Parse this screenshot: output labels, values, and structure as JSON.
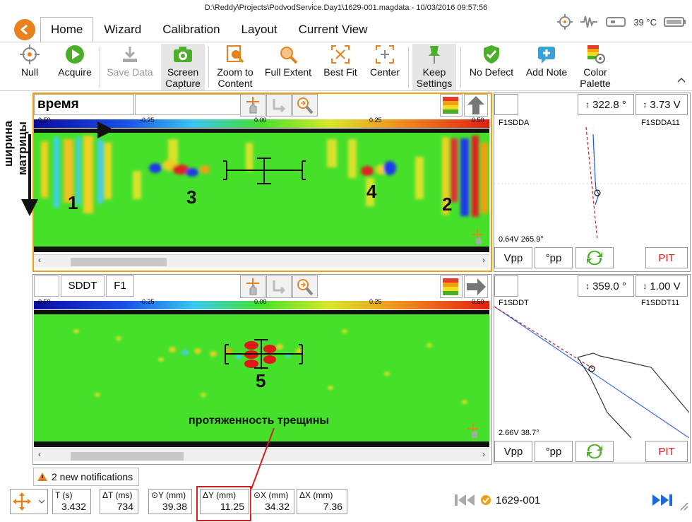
{
  "window": {
    "title": "D:\\Reddy\\Projects\\PodvodService.Day1\\1629-001.magdata - 10/03/2016 09:57:56"
  },
  "tabs": [
    "Home",
    "Wizard",
    "Calibration",
    "Layout",
    "Current View"
  ],
  "status": {
    "temperature": "39 °C"
  },
  "ribbon": {
    "null": "Null",
    "acquire": "Acquire",
    "save_data": "Save Data",
    "screen_capture_1": "Screen",
    "screen_capture_2": "Capture",
    "zoom_1": "Zoom to",
    "zoom_2": "Content",
    "full_extent": "Full Extent",
    "best_fit": "Best Fit",
    "center": "Center",
    "keep_1": "Keep",
    "keep_2": "Settings",
    "no_defect": "No Defect",
    "add_note": "Add Note",
    "palette_1": "Color",
    "palette_2": "Palette"
  },
  "scale": {
    "t0": "-0.50",
    "t1": "-0.25",
    "t2": "0.00",
    "t3": "0.25",
    "t4": "0.50"
  },
  "top_panel": {
    "title": "время",
    "channel_left": "F1SDDA",
    "channel_right": "F1SDDA11",
    "angle": "322.8 °",
    "volts": "3.73 V",
    "readout": "0.64V 265.9°",
    "btn_vpp": "Vpp",
    "btn_pp": "°pp",
    "btn_pit": "PIT"
  },
  "bottom_panel": {
    "ch1": "SDDT",
    "ch2": "F1",
    "channel_left": "F1SDDT",
    "channel_right": "F1SDDT11",
    "angle": "359.0 °",
    "volts": "1.00 V",
    "readout": "2.66V 38.7°",
    "btn_vpp": "Vpp",
    "btn_pp": "°pp",
    "btn_pit": "PIT"
  },
  "annotations": {
    "side_1": "ширина",
    "side_2": "матрицы",
    "n1": "1",
    "n2": "2",
    "n3": "3",
    "n4": "4",
    "n5": "5",
    "crack": "протяженность трещины"
  },
  "notifications": "2 new notifications",
  "measurements": [
    {
      "h": "T (s)",
      "v": "3.432"
    },
    {
      "h": "ΔT (ms)",
      "v": "734"
    },
    {
      "h": "⊙Y (mm)",
      "v": "39.38"
    },
    {
      "h": "ΔY (mm)",
      "v": "11.25"
    },
    {
      "h": "⊙X (mm)",
      "v": "34.32"
    },
    {
      "h": "ΔX (mm)",
      "v": "7.36"
    }
  ],
  "file": "1629-001",
  "colors": {
    "orange": "#e8821e",
    "red_annot": "#d02020",
    "field_green": "#45e02a"
  }
}
